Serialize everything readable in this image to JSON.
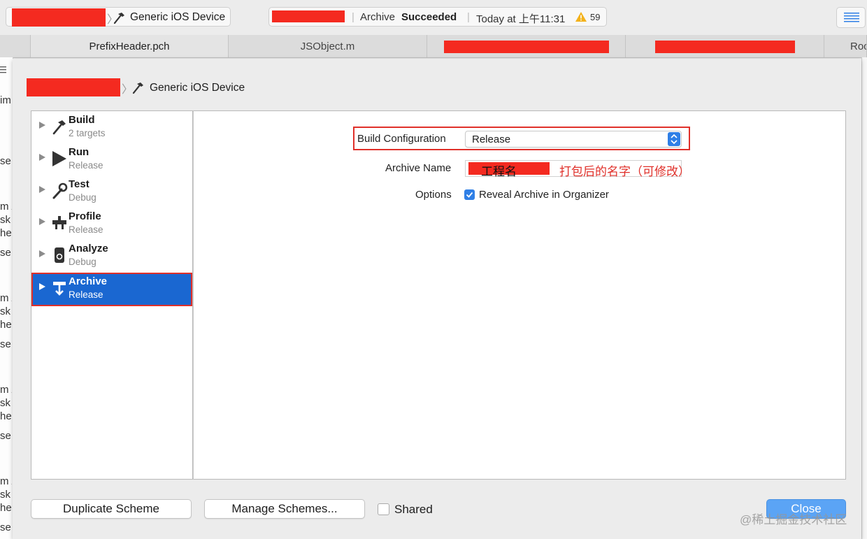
{
  "toolbar": {
    "scheme_device": "Generic iOS Device",
    "status_action": "Archive",
    "status_result": "Succeeded",
    "status_time": "Today at 上午11:31",
    "warning_count": "59"
  },
  "tabs": [
    "PrefixHeader.pch",
    "JSObject.m",
    "",
    "",
    "Roo"
  ],
  "background_editor": {
    "fragments": [
      "im",
      "se",
      "m /",
      "sk",
      "he",
      "se",
      "m /",
      "sk",
      "he",
      "se",
      "m /",
      "sk",
      "he",
      "se",
      "m /",
      "sk",
      "he",
      "se"
    ]
  },
  "sheet": {
    "scheme_device": "Generic iOS Device",
    "actions": [
      {
        "name": "Build",
        "sub": "2 targets"
      },
      {
        "name": "Run",
        "sub": "Release"
      },
      {
        "name": "Test",
        "sub": "Debug"
      },
      {
        "name": "Profile",
        "sub": "Release"
      },
      {
        "name": "Analyze",
        "sub": "Debug"
      },
      {
        "name": "Archive",
        "sub": "Release"
      }
    ],
    "build_configuration_label": "Build Configuration",
    "build_configuration_value": "Release",
    "archive_name_label": "Archive Name",
    "archive_name_value": "工程名",
    "archive_name_annotation": "打包后的名字（可修改）",
    "options_label": "Options",
    "reveal_label": "Reveal Archive in Organizer",
    "reveal_checked": true,
    "duplicate_button": "Duplicate Scheme",
    "manage_button": "Manage Schemes...",
    "shared_label": "Shared",
    "shared_checked": false,
    "close_button": "Close"
  },
  "watermark": "@稀土掘金技术社区",
  "colors": {
    "selection": "#1a67d1",
    "annotation_red": "#e0302a",
    "redaction": "#f42a20",
    "accent_blue": "#2f7fe6"
  }
}
